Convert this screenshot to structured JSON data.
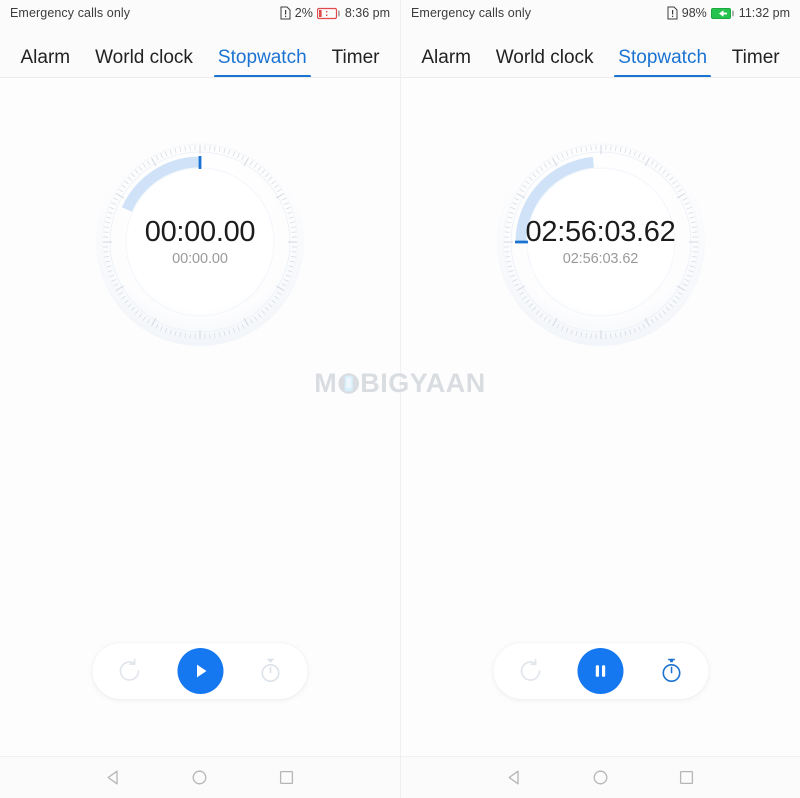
{
  "colors": {
    "accent": "#1a73d2",
    "button_blue": "#1578f0",
    "arc_light": "#cfe2f7",
    "text_primary": "#1c1c1c",
    "text_secondary": "#9a9a9a",
    "background": "#fbfbfb",
    "battery_low": "#e04a4a",
    "battery_charging": "#25c24e",
    "watermark": "#d9dde2"
  },
  "screens": [
    {
      "id": "left",
      "status": {
        "carrier": "Emergency calls only",
        "sim_icon": "sim-alert-icon",
        "battery_percent": "2%",
        "battery_icon": "battery-low-icon",
        "battery_state": "low",
        "time": "8:36 pm"
      },
      "tabs": [
        {
          "label": "Alarm",
          "name": "tab-alarm",
          "active": false
        },
        {
          "label": "World clock",
          "name": "tab-world-clock",
          "active": false
        },
        {
          "label": "Stopwatch",
          "name": "tab-stopwatch",
          "active": true
        },
        {
          "label": "Timer",
          "name": "tab-timer",
          "active": false
        }
      ],
      "stopwatch": {
        "time_main": "00:00.00",
        "time_sub": "00:00.00",
        "progress_deg": 0,
        "marker_deg": 0,
        "arc_start_deg": -66,
        "arc_end_deg": 0,
        "state": "stopped"
      },
      "controls": {
        "reset": {
          "label": "Reset",
          "name": "reset-button",
          "icon": "reset-icon",
          "enabled": false
        },
        "main": {
          "label": "Start",
          "name": "start-button",
          "icon": "play-icon",
          "state": "play"
        },
        "lap": {
          "label": "Lap",
          "name": "lap-button",
          "icon": "stopwatch-icon",
          "enabled": false
        }
      }
    },
    {
      "id": "right",
      "status": {
        "carrier": "Emergency calls only",
        "sim_icon": "sim-alert-icon",
        "battery_percent": "98%",
        "battery_icon": "battery-charging-icon",
        "battery_state": "charging",
        "time": "11:32 pm"
      },
      "tabs": [
        {
          "label": "Alarm",
          "name": "tab-alarm",
          "active": false
        },
        {
          "label": "World clock",
          "name": "tab-world-clock",
          "active": false
        },
        {
          "label": "Stopwatch",
          "name": "tab-stopwatch",
          "active": true
        },
        {
          "label": "Timer",
          "name": "tab-timer",
          "active": false
        }
      ],
      "stopwatch": {
        "time_main": "02:56:03.62",
        "time_sub": "02:56:03.62",
        "progress_deg": 270,
        "marker_deg": 270,
        "arc_start_deg": 270,
        "arc_end_deg": 352,
        "state": "running"
      },
      "controls": {
        "reset": {
          "label": "Reset",
          "name": "reset-button",
          "icon": "reset-icon",
          "enabled": false
        },
        "main": {
          "label": "Pause",
          "name": "pause-button",
          "icon": "pause-icon",
          "state": "pause"
        },
        "lap": {
          "label": "Lap",
          "name": "lap-button",
          "icon": "stopwatch-icon",
          "enabled": true
        }
      }
    }
  ],
  "watermark": {
    "text_before": "M",
    "text_o": "O",
    "text_after": "BIGYAAN",
    "full": "MOBIGYAAN"
  },
  "navbar": [
    {
      "name": "nav-back-button",
      "icon": "back-triangle-icon"
    },
    {
      "name": "nav-home-button",
      "icon": "home-circle-icon"
    },
    {
      "name": "nav-recents-button",
      "icon": "recents-square-icon"
    }
  ]
}
